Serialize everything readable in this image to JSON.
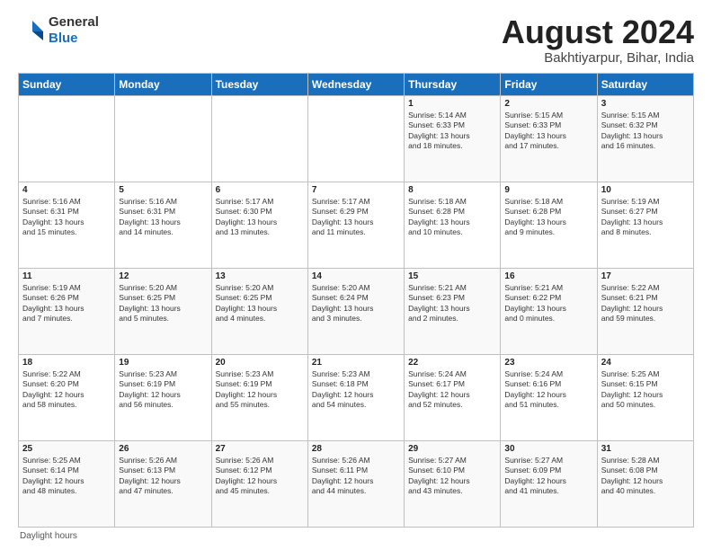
{
  "logo": {
    "general": "General",
    "blue": "Blue"
  },
  "title": "August 2024",
  "subtitle": "Bakhtiyarpur, Bihar, India",
  "days_of_week": [
    "Sunday",
    "Monday",
    "Tuesday",
    "Wednesday",
    "Thursday",
    "Friday",
    "Saturday"
  ],
  "weeks": [
    [
      {
        "day": "",
        "info": ""
      },
      {
        "day": "",
        "info": ""
      },
      {
        "day": "",
        "info": ""
      },
      {
        "day": "",
        "info": ""
      },
      {
        "day": "1",
        "info": "Sunrise: 5:14 AM\nSunset: 6:33 PM\nDaylight: 13 hours\nand 18 minutes."
      },
      {
        "day": "2",
        "info": "Sunrise: 5:15 AM\nSunset: 6:33 PM\nDaylight: 13 hours\nand 17 minutes."
      },
      {
        "day": "3",
        "info": "Sunrise: 5:15 AM\nSunset: 6:32 PM\nDaylight: 13 hours\nand 16 minutes."
      }
    ],
    [
      {
        "day": "4",
        "info": "Sunrise: 5:16 AM\nSunset: 6:31 PM\nDaylight: 13 hours\nand 15 minutes."
      },
      {
        "day": "5",
        "info": "Sunrise: 5:16 AM\nSunset: 6:31 PM\nDaylight: 13 hours\nand 14 minutes."
      },
      {
        "day": "6",
        "info": "Sunrise: 5:17 AM\nSunset: 6:30 PM\nDaylight: 13 hours\nand 13 minutes."
      },
      {
        "day": "7",
        "info": "Sunrise: 5:17 AM\nSunset: 6:29 PM\nDaylight: 13 hours\nand 11 minutes."
      },
      {
        "day": "8",
        "info": "Sunrise: 5:18 AM\nSunset: 6:28 PM\nDaylight: 13 hours\nand 10 minutes."
      },
      {
        "day": "9",
        "info": "Sunrise: 5:18 AM\nSunset: 6:28 PM\nDaylight: 13 hours\nand 9 minutes."
      },
      {
        "day": "10",
        "info": "Sunrise: 5:19 AM\nSunset: 6:27 PM\nDaylight: 13 hours\nand 8 minutes."
      }
    ],
    [
      {
        "day": "11",
        "info": "Sunrise: 5:19 AM\nSunset: 6:26 PM\nDaylight: 13 hours\nand 7 minutes."
      },
      {
        "day": "12",
        "info": "Sunrise: 5:20 AM\nSunset: 6:25 PM\nDaylight: 13 hours\nand 5 minutes."
      },
      {
        "day": "13",
        "info": "Sunrise: 5:20 AM\nSunset: 6:25 PM\nDaylight: 13 hours\nand 4 minutes."
      },
      {
        "day": "14",
        "info": "Sunrise: 5:20 AM\nSunset: 6:24 PM\nDaylight: 13 hours\nand 3 minutes."
      },
      {
        "day": "15",
        "info": "Sunrise: 5:21 AM\nSunset: 6:23 PM\nDaylight: 13 hours\nand 2 minutes."
      },
      {
        "day": "16",
        "info": "Sunrise: 5:21 AM\nSunset: 6:22 PM\nDaylight: 13 hours\nand 0 minutes."
      },
      {
        "day": "17",
        "info": "Sunrise: 5:22 AM\nSunset: 6:21 PM\nDaylight: 12 hours\nand 59 minutes."
      }
    ],
    [
      {
        "day": "18",
        "info": "Sunrise: 5:22 AM\nSunset: 6:20 PM\nDaylight: 12 hours\nand 58 minutes."
      },
      {
        "day": "19",
        "info": "Sunrise: 5:23 AM\nSunset: 6:19 PM\nDaylight: 12 hours\nand 56 minutes."
      },
      {
        "day": "20",
        "info": "Sunrise: 5:23 AM\nSunset: 6:19 PM\nDaylight: 12 hours\nand 55 minutes."
      },
      {
        "day": "21",
        "info": "Sunrise: 5:23 AM\nSunset: 6:18 PM\nDaylight: 12 hours\nand 54 minutes."
      },
      {
        "day": "22",
        "info": "Sunrise: 5:24 AM\nSunset: 6:17 PM\nDaylight: 12 hours\nand 52 minutes."
      },
      {
        "day": "23",
        "info": "Sunrise: 5:24 AM\nSunset: 6:16 PM\nDaylight: 12 hours\nand 51 minutes."
      },
      {
        "day": "24",
        "info": "Sunrise: 5:25 AM\nSunset: 6:15 PM\nDaylight: 12 hours\nand 50 minutes."
      }
    ],
    [
      {
        "day": "25",
        "info": "Sunrise: 5:25 AM\nSunset: 6:14 PM\nDaylight: 12 hours\nand 48 minutes."
      },
      {
        "day": "26",
        "info": "Sunrise: 5:26 AM\nSunset: 6:13 PM\nDaylight: 12 hours\nand 47 minutes."
      },
      {
        "day": "27",
        "info": "Sunrise: 5:26 AM\nSunset: 6:12 PM\nDaylight: 12 hours\nand 45 minutes."
      },
      {
        "day": "28",
        "info": "Sunrise: 5:26 AM\nSunset: 6:11 PM\nDaylight: 12 hours\nand 44 minutes."
      },
      {
        "day": "29",
        "info": "Sunrise: 5:27 AM\nSunset: 6:10 PM\nDaylight: 12 hours\nand 43 minutes."
      },
      {
        "day": "30",
        "info": "Sunrise: 5:27 AM\nSunset: 6:09 PM\nDaylight: 12 hours\nand 41 minutes."
      },
      {
        "day": "31",
        "info": "Sunrise: 5:28 AM\nSunset: 6:08 PM\nDaylight: 12 hours\nand 40 minutes."
      }
    ]
  ],
  "footer": {
    "daylight_hours": "Daylight hours"
  }
}
